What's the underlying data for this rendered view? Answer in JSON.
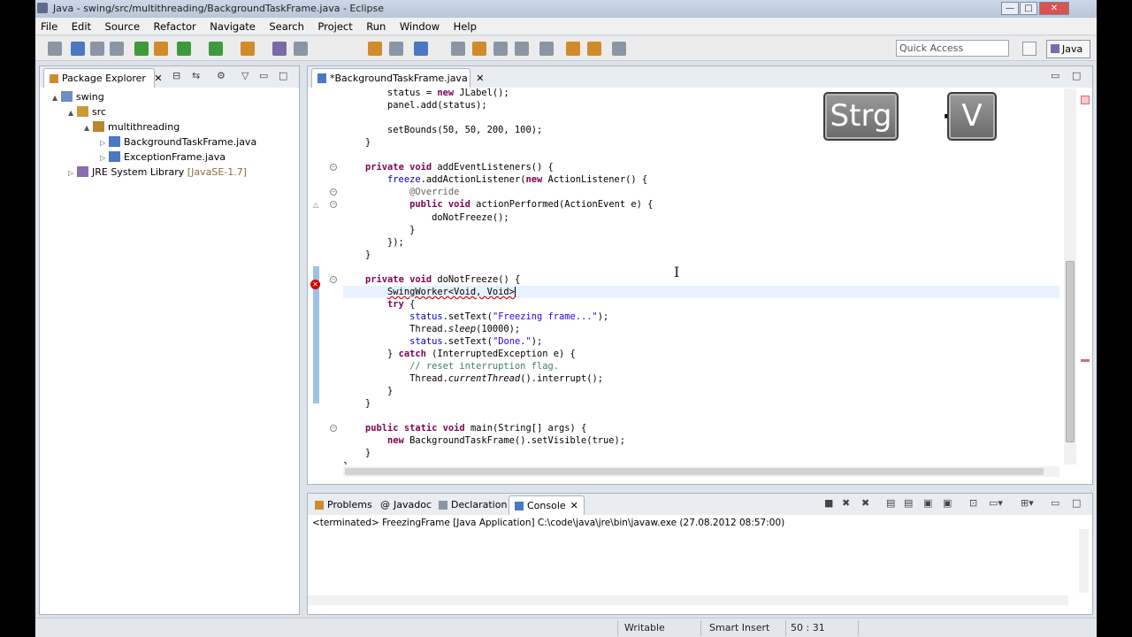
{
  "window": {
    "title": "Java - swing/src/multithreading/BackgroundTaskFrame.java - Eclipse",
    "controls": {
      "minimize": "—",
      "maximize": "□",
      "close": "✕"
    }
  },
  "menu": [
    "File",
    "Edit",
    "Source",
    "Refactor",
    "Navigate",
    "Search",
    "Project",
    "Run",
    "Window",
    "Help"
  ],
  "toolbar": {
    "quick_access_placeholder": "Quick Access",
    "perspective": "Java"
  },
  "package_explorer": {
    "tab_label": "Package Explorer",
    "tab_close": "✕",
    "tree": [
      {
        "label": "swing",
        "depth": 0,
        "twisty": "▲",
        "icon": "project-icon"
      },
      {
        "label": "src",
        "depth": 1,
        "twisty": "▲",
        "icon": "source-folder-icon"
      },
      {
        "label": "multithreading",
        "depth": 2,
        "twisty": "▲",
        "icon": "package-icon"
      },
      {
        "label": "BackgroundTaskFrame.java",
        "depth": 3,
        "twisty": "▷",
        "icon": "java-file-icon"
      },
      {
        "label": "ExceptionFrame.java",
        "depth": 3,
        "twisty": "▷",
        "icon": "java-file-icon"
      },
      {
        "label": "JRE System Library",
        "suffix": " [JavaSE-1.7]",
        "depth": 1,
        "twisty": "▷",
        "icon": "library-icon"
      }
    ]
  },
  "editor": {
    "tab_label": "*BackgroundTaskFrame.java",
    "tab_close": "✕",
    "lines": [
      "        status = new JLabel();",
      "        panel.add(status);",
      "",
      "        setBounds(50, 50, 200, 100);",
      "    }",
      "",
      "    private void addEventListeners() {",
      "        freeze.addActionListener(new ActionListener() {",
      "            @Override",
      "            public void actionPerformed(ActionEvent e) {",
      "                doNotFreeze();",
      "            }",
      "        });",
      "    }",
      "",
      "    private void doNotFreeze() {",
      "        SwingWorker<Void, Void>",
      "        try {",
      "            status.setText(\"Freezing frame...\");",
      "            Thread.sleep(10000);",
      "            status.setText(\"Done.\");",
      "        } catch (InterruptedException e) {",
      "            // reset interruption flag.",
      "            Thread.currentThread().interrupt();",
      "        }",
      "    }",
      "",
      "    public static void main(String[] args) {",
      "        new BackgroundTaskFrame().setVisible(true);",
      "    }",
      "}"
    ],
    "current_line": 16
  },
  "key_overlay": {
    "key1": "Strg",
    "plus": "+",
    "key2": "V"
  },
  "console_view": {
    "tabs": [
      "Problems",
      "Javadoc",
      "Declaration",
      "Console"
    ],
    "tab_icons": [
      "problems-icon",
      "javadoc-icon",
      "declaration-icon",
      "console-icon"
    ],
    "tab_close": "✕",
    "status_line": "<terminated> FreezingFrame [Java Application] C:\\code\\java\\jre\\bin\\javaw.exe (27.08.2012 08:57:00)"
  },
  "statusbar": {
    "mode": "Writable",
    "insert": "Smart Insert",
    "position": "50 : 31"
  },
  "colors": {
    "keyword": "#7f0055",
    "string": "#2a00ff",
    "comment": "#3f7f5f",
    "annotation": "#646464",
    "field": "#0000c0",
    "error": "#d60000"
  }
}
